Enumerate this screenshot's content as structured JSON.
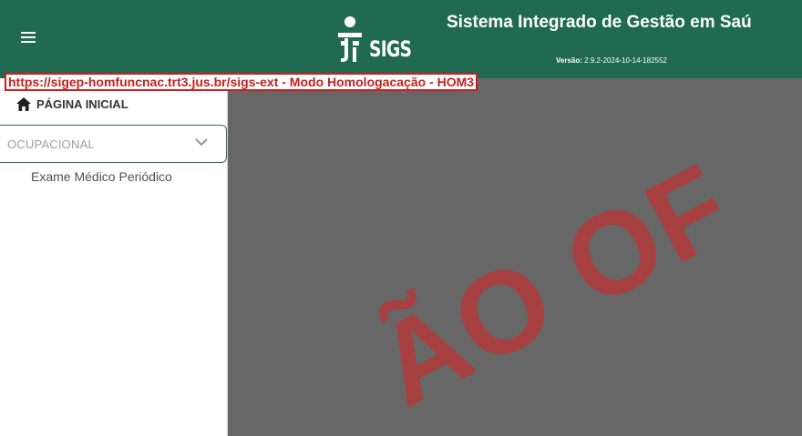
{
  "header": {
    "logo_text": "SIGS",
    "title": "Sistema Integrado de Gestão em Saú",
    "version_label": "Versão:",
    "version_value": "2.9.2-2024-10-14-182552"
  },
  "environment_banner": "https://sigep-homfuncnac.trt3.jus.br/sigs-ext - Modo Homologacação - HOM3",
  "sidebar": {
    "home_label": "PÁGINA INICIAL",
    "group_label": "OCUPACIONAL",
    "items": [
      {
        "label": "Exame Médico Periódico"
      }
    ]
  },
  "watermark": "ÃO OF",
  "colors": {
    "header_bg": "#1f6a50",
    "banner_border": "#d41b1b",
    "content_bg": "#676767",
    "watermark": "#b33a3a"
  },
  "icons": [
    "menu-icon",
    "sigs-logo-figure-icon",
    "home-icon",
    "chevron-down-icon"
  ]
}
